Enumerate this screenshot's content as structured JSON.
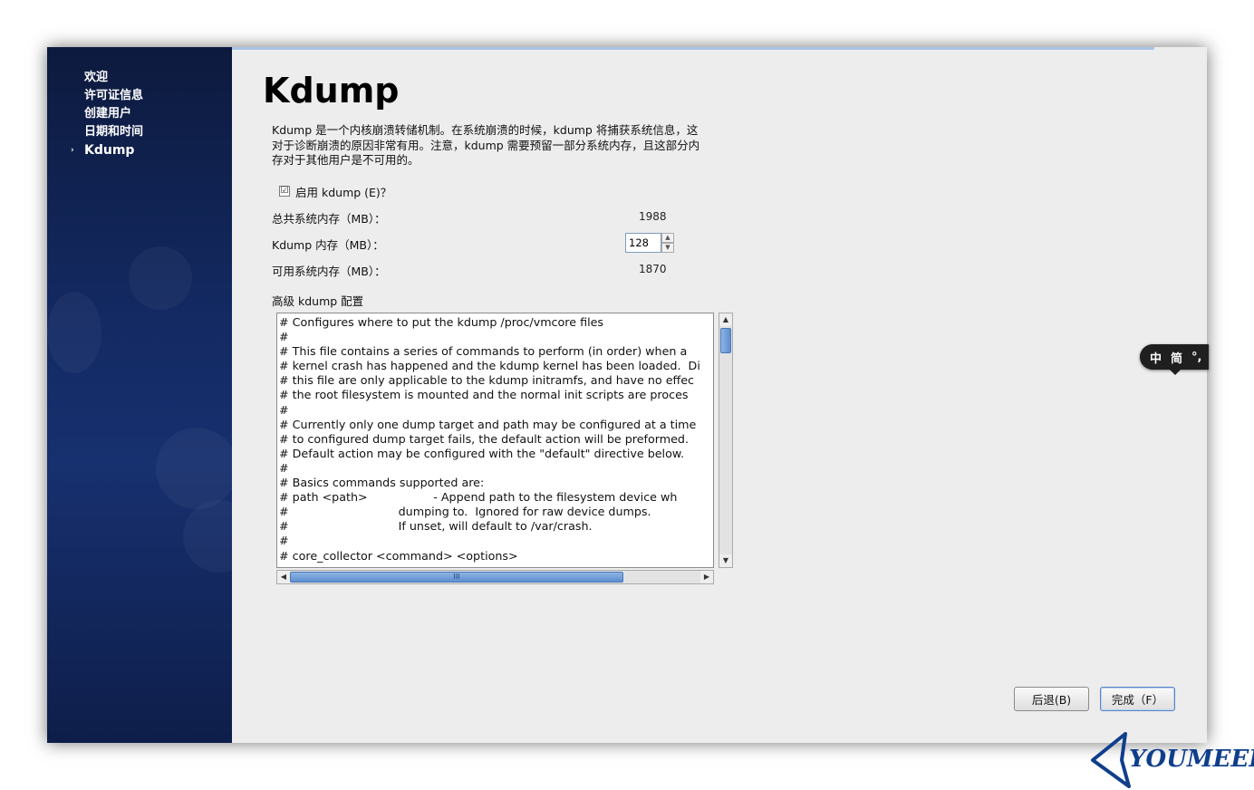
{
  "sidebar": {
    "items": [
      {
        "label": "欢迎"
      },
      {
        "label": "许可证信息"
      },
      {
        "label": "创建用户"
      },
      {
        "label": "日期和时间"
      },
      {
        "label": "Kdump",
        "active": true
      }
    ],
    "active_marker": "›"
  },
  "page": {
    "title": "Kdump",
    "description_line1": "Kdump 是一个内核崩溃转储机制。在系统崩溃的时候，kdump 将捕获系统信息，这",
    "description_line2": "对于诊断崩溃的原因非常有用。注意，kdump 需要预留一部分系统内存，且这部分内",
    "description_line3": "存对于其他用户是不可用的。",
    "enable_checkbox": {
      "label": "启用 kdump (E)？",
      "checked": true,
      "mark": "☑"
    },
    "total_memory": {
      "label": "总共系统内存（MB）：",
      "value": "1988"
    },
    "kdump_memory": {
      "label": "Kdump 内存（MB）：",
      "value": "128"
    },
    "usable_memory": {
      "label": "可用系统内存（MB）：",
      "value": "1870"
    },
    "advanced_title": "高级 kdump 配置",
    "config_lines": [
      "# Configures where to put the kdump /proc/vmcore files",
      "#",
      "# This file contains a series of commands to perform (in order) when a",
      "# kernel crash has happened and the kdump kernel has been loaded.  Di",
      "# this file are only applicable to the kdump initramfs, and have no effec",
      "# the root filesystem is mounted and the normal init scripts are proces",
      "#",
      "# Currently only one dump target and path may be configured at a time",
      "# to configured dump target fails, the default action will be preformed.",
      "# Default action may be configured with the \"default\" directive below.",
      "#",
      "# Basics commands supported are:",
      "# path <path>                  - Append path to the filesystem device wh",
      "#                              dumping to.  Ignored for raw device dumps.",
      "#                              If unset, will default to /var/crash.",
      "#",
      "# core_collector <command> <options>"
    ],
    "hscroll_grip": "III"
  },
  "buttons": {
    "back": "后退(B)",
    "finish": "完成（F）"
  },
  "ime": {
    "lang": "中",
    "mode": "简",
    "punct": "°,"
  },
  "watermark": {
    "text": "YOUMEEK"
  }
}
